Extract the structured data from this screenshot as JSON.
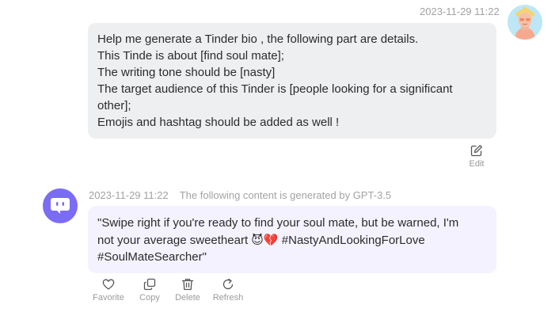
{
  "user_message": {
    "timestamp": "2023-11-29 11:22",
    "lines": [
      "Help me generate a Tinder bio , the following part are details.",
      "This Tinde is about [find soul mate];",
      "The writing tone should be [nasty]",
      "The target audience of this Tinder is [people looking for a significant",
      "other];",
      "Emojis and hashtag should be added as well !"
    ],
    "edit_label": "Edit"
  },
  "bot_message": {
    "timestamp": "2023-11-29 11:22",
    "generated_note": "The following content is generated by GPT-3.5",
    "lines": [
      "\"Swipe right if you're ready to find your soul mate, but be warned, I'm",
      "not your average sweetheart 😈💔 #NastyAndLookingForLove",
      "#SoulMateSearcher\""
    ]
  },
  "actions": {
    "favorite": "Favorite",
    "copy": "Copy",
    "delete": "Delete",
    "refresh": "Refresh"
  },
  "colors": {
    "bot_accent": "#7b6cf6",
    "user_bubble": "#eeeff1",
    "bot_bubble": "#f4f2fe",
    "user_avatar_bg": "#bde7f6"
  }
}
